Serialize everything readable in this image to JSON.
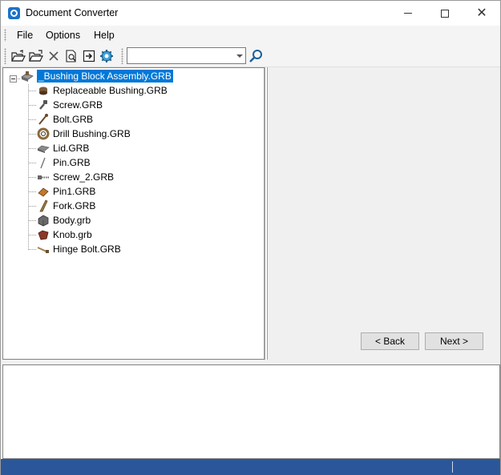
{
  "window": {
    "title": "Document Converter"
  },
  "menu": {
    "file": "File",
    "options": "Options",
    "help": "Help"
  },
  "toolbar": {
    "buttons": [
      "open-folder-icon",
      "open-file-icon",
      "delete-icon",
      "preview-icon",
      "export-icon",
      "settings-icon"
    ],
    "combo_value": "",
    "search_icon": "magnifier-icon"
  },
  "tree": {
    "root": {
      "label": "_Bushing Block Assembly.GRB",
      "icon": "assembly-icon"
    },
    "children": [
      {
        "label": "Replaceable Bushing.GRB",
        "icon": "bushing-icon",
        "color": "#7a5a3a"
      },
      {
        "label": "Screw.GRB",
        "icon": "screw-icon",
        "color": "#555555"
      },
      {
        "label": "Bolt.GRB",
        "icon": "bolt-icon",
        "color": "#6b4a2a"
      },
      {
        "label": "Drill Bushing.GRB",
        "icon": "ring-icon",
        "color": "#8a6a3a"
      },
      {
        "label": "Lid.GRB",
        "icon": "lid-icon",
        "color": "#8a8a8a"
      },
      {
        "label": "Pin.GRB",
        "icon": "pin-icon",
        "color": "#777777"
      },
      {
        "label": "Screw_2.GRB",
        "icon": "screw2-icon",
        "color": "#666666"
      },
      {
        "label": "Pin1.GRB",
        "icon": "pin1-icon",
        "color": "#c07a2a"
      },
      {
        "label": "Fork.GRB",
        "icon": "fork-icon",
        "color": "#a07a40"
      },
      {
        "label": "Body.grb",
        "icon": "body-icon",
        "color": "#6a6a6a"
      },
      {
        "label": "Knob.grb",
        "icon": "knob-icon",
        "color": "#8a3a2a"
      },
      {
        "label": "Hinge Bolt.GRB",
        "icon": "hinge-bolt-icon",
        "color": "#a08050"
      }
    ]
  },
  "wizard": {
    "back": "< Back",
    "next": "Next >"
  },
  "colors": {
    "selection": "#0078d7",
    "statusbar": "#2b579a",
    "accent": "#1a73c9"
  }
}
